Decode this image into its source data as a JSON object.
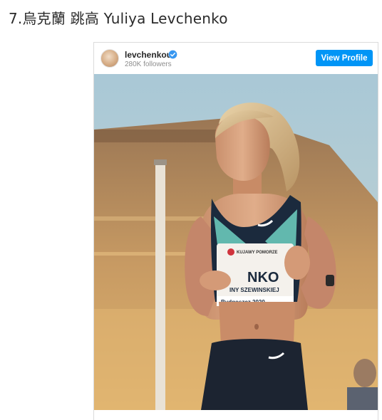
{
  "page": {
    "heading": "7.烏克蘭 跳高 Yuliya Levchenko"
  },
  "instagram_embed": {
    "username": "levchenkou",
    "followers": "280K followers",
    "view_profile_label": "View Profile",
    "accent_color": "#0095f6",
    "photo": {
      "bib_lines": [
        "KUJAWY POMORZE",
        "NKO",
        "INY SZEWINSKIEJ",
        "Bydgoszcz 2020"
      ]
    }
  }
}
